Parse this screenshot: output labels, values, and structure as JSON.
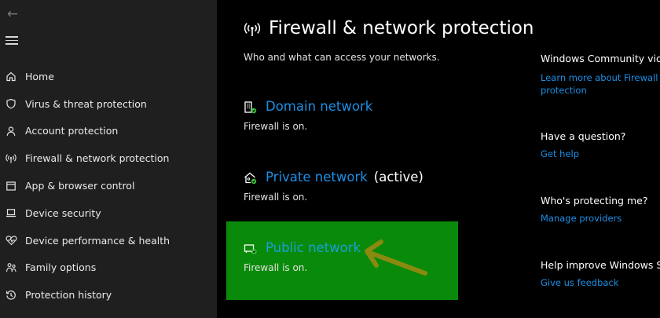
{
  "sidebar": {
    "items": [
      {
        "icon": "home-icon",
        "label": "Home"
      },
      {
        "icon": "shield-icon",
        "label": "Virus & threat protection"
      },
      {
        "icon": "person-icon",
        "label": "Account protection"
      },
      {
        "icon": "antenna-icon",
        "label": "Firewall & network protection"
      },
      {
        "icon": "browser-window-icon",
        "label": "App & browser control"
      },
      {
        "icon": "laptop-icon",
        "label": "Device security"
      },
      {
        "icon": "heart-pulse-icon",
        "label": "Device performance & health"
      },
      {
        "icon": "family-icon",
        "label": "Family options"
      },
      {
        "icon": "history-icon",
        "label": "Protection history"
      }
    ]
  },
  "main": {
    "title": "Firewall & network protection",
    "subtitle": "Who and what can access your networks.",
    "networks": [
      {
        "name": "Domain network",
        "active_label": "",
        "status": "Firewall is on."
      },
      {
        "name": "Private network",
        "active_label": "(active)",
        "status": "Firewall is on."
      },
      {
        "name": "Public network",
        "active_label": "",
        "status": "Firewall is on."
      }
    ]
  },
  "right_panel": {
    "community_heading": "Windows Community vide",
    "community_link_line1": "Learn more about Firewall &",
    "community_link_line2": "protection",
    "question_heading": "Have a question?",
    "question_link": "Get help",
    "protecting_heading": "Who's protecting me?",
    "protecting_link": "Manage providers",
    "improve_heading": "Help improve Windows Se",
    "improve_link": "Give us feedback"
  },
  "colors": {
    "accent_link": "#1c8fe6",
    "highlight_green": "#0a8a0a",
    "arrow_olive": "#8a8a10",
    "status_check_green": "#3cc23c"
  }
}
